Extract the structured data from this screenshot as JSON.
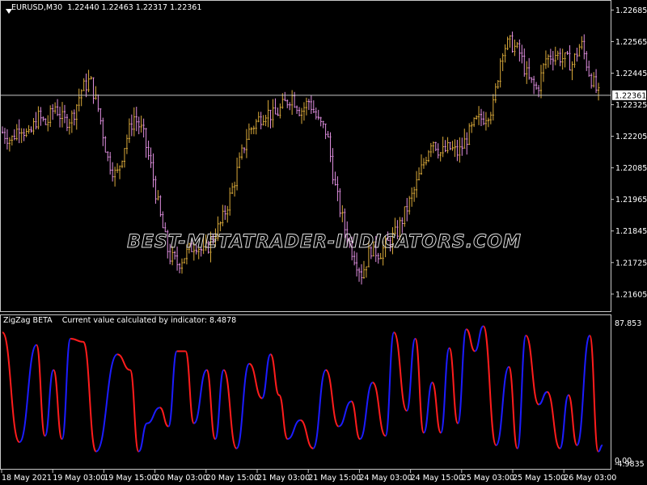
{
  "chart": {
    "symbol_header": "EURUSD,M30  1.22440 1.22463 1.22317 1.22361",
    "indicator_header": "ZigZag BETA    Current value calculated by indicator: 8.4878",
    "watermark": "BEST-METATRADER-INDICATORS.COM",
    "current_price_label": "1.22361",
    "current_price": 1.22361,
    "colors": {
      "bull_candle": "#d9a93a",
      "bear_candle": "#e08fe0",
      "osc_up": "#1c1cff",
      "osc_down": "#ff1c1c",
      "grid": "#c8c8c8"
    }
  },
  "chart_data": [
    {
      "type": "candlestick",
      "ylim": [
        1.2154,
        1.2272
      ],
      "price_ticks": [
        "1.22685",
        "1.22565",
        "1.22445",
        "1.22325",
        "1.22205",
        "1.22085",
        "1.21965",
        "1.21845",
        "1.21725",
        "1.21605"
      ],
      "x_ticks": [
        "18 May 2021",
        "19 May 03:00",
        "19 May 15:00",
        "20 May 03:00",
        "20 May 15:00",
        "21 May 03:00",
        "21 May 15:00",
        "24 May 03:00",
        "24 May 15:00",
        "25 May 03:00",
        "25 May 15:00",
        "26 May 03:00"
      ],
      "close_path": [
        1.2222,
        1.2219,
        1.2225,
        1.222,
        1.2228,
        1.2225,
        1.2232,
        1.2226,
        1.2228,
        1.2238,
        1.2242,
        1.223,
        1.2212,
        1.2205,
        1.2218,
        1.2228,
        1.2222,
        1.2208,
        1.219,
        1.2175,
        1.2172,
        1.2176,
        1.218,
        1.2176,
        1.2182,
        1.2188,
        1.2198,
        1.221,
        1.2222,
        1.2226,
        1.223,
        1.2228,
        1.2232,
        1.2236,
        1.223,
        1.2234,
        1.2226,
        1.2222,
        1.22,
        1.2186,
        1.2176,
        1.2168,
        1.2178,
        1.2176,
        1.218,
        1.2184,
        1.2192,
        1.22,
        1.221,
        1.222,
        1.2214,
        1.2216,
        1.2214,
        1.222,
        1.2226,
        1.2228,
        1.2232,
        1.2254,
        1.2256,
        1.2252,
        1.2242,
        1.2238,
        1.225,
        1.2252,
        1.225,
        1.2248,
        1.2256,
        1.2244,
        1.2236
      ]
    },
    {
      "type": "line",
      "ylim": [
        -4.9835,
        87.853
      ],
      "y_ticks": [
        "87.853",
        "0.00",
        "-4.9835"
      ],
      "x_ticks": [
        "18 May 2021",
        "19 May 03:00",
        "19 May 15:00",
        "20 May 03:00",
        "20 May 15:00",
        "21 May 03:00",
        "21 May 15:00",
        "24 May 03:00",
        "24 May 15:00",
        "25 May 03:00",
        "25 May 15:00",
        "26 May 03:00"
      ],
      "current_value": 8.4878,
      "pivots": [
        [
          0,
          80
        ],
        [
          4,
          10
        ],
        [
          8,
          72
        ],
        [
          10,
          14
        ],
        [
          12,
          56
        ],
        [
          14,
          12
        ],
        [
          16,
          76
        ],
        [
          19,
          74
        ],
        [
          22,
          4
        ],
        [
          27,
          66
        ],
        [
          30,
          56
        ],
        [
          32,
          4
        ],
        [
          34,
          22
        ],
        [
          37,
          32
        ],
        [
          39,
          20
        ],
        [
          41,
          68
        ],
        [
          43,
          68
        ],
        [
          45,
          22
        ],
        [
          48,
          56
        ],
        [
          50,
          12
        ],
        [
          52,
          56
        ],
        [
          55,
          6
        ],
        [
          58,
          60
        ],
        [
          61,
          38
        ],
        [
          63,
          66
        ],
        [
          65,
          40
        ],
        [
          67,
          12
        ],
        [
          70,
          24
        ],
        [
          73,
          6
        ],
        [
          76,
          56
        ],
        [
          79,
          20
        ],
        [
          82,
          36
        ],
        [
          84,
          12
        ],
        [
          87,
          48
        ],
        [
          90,
          14
        ],
        [
          92,
          80
        ],
        [
          95,
          30
        ],
        [
          97,
          76
        ],
        [
          99,
          16
        ],
        [
          101,
          48
        ],
        [
          103,
          16
        ],
        [
          105,
          70
        ],
        [
          107,
          22
        ],
        [
          109,
          82
        ],
        [
          111,
          68
        ],
        [
          113,
          84
        ],
        [
          116,
          8
        ],
        [
          119,
          58
        ],
        [
          121,
          6
        ],
        [
          123,
          78
        ],
        [
          126,
          34
        ],
        [
          128,
          42
        ],
        [
          131,
          6
        ],
        [
          133,
          40
        ],
        [
          135,
          8
        ],
        [
          138,
          78
        ],
        [
          140,
          4
        ],
        [
          141,
          8
        ]
      ]
    }
  ]
}
